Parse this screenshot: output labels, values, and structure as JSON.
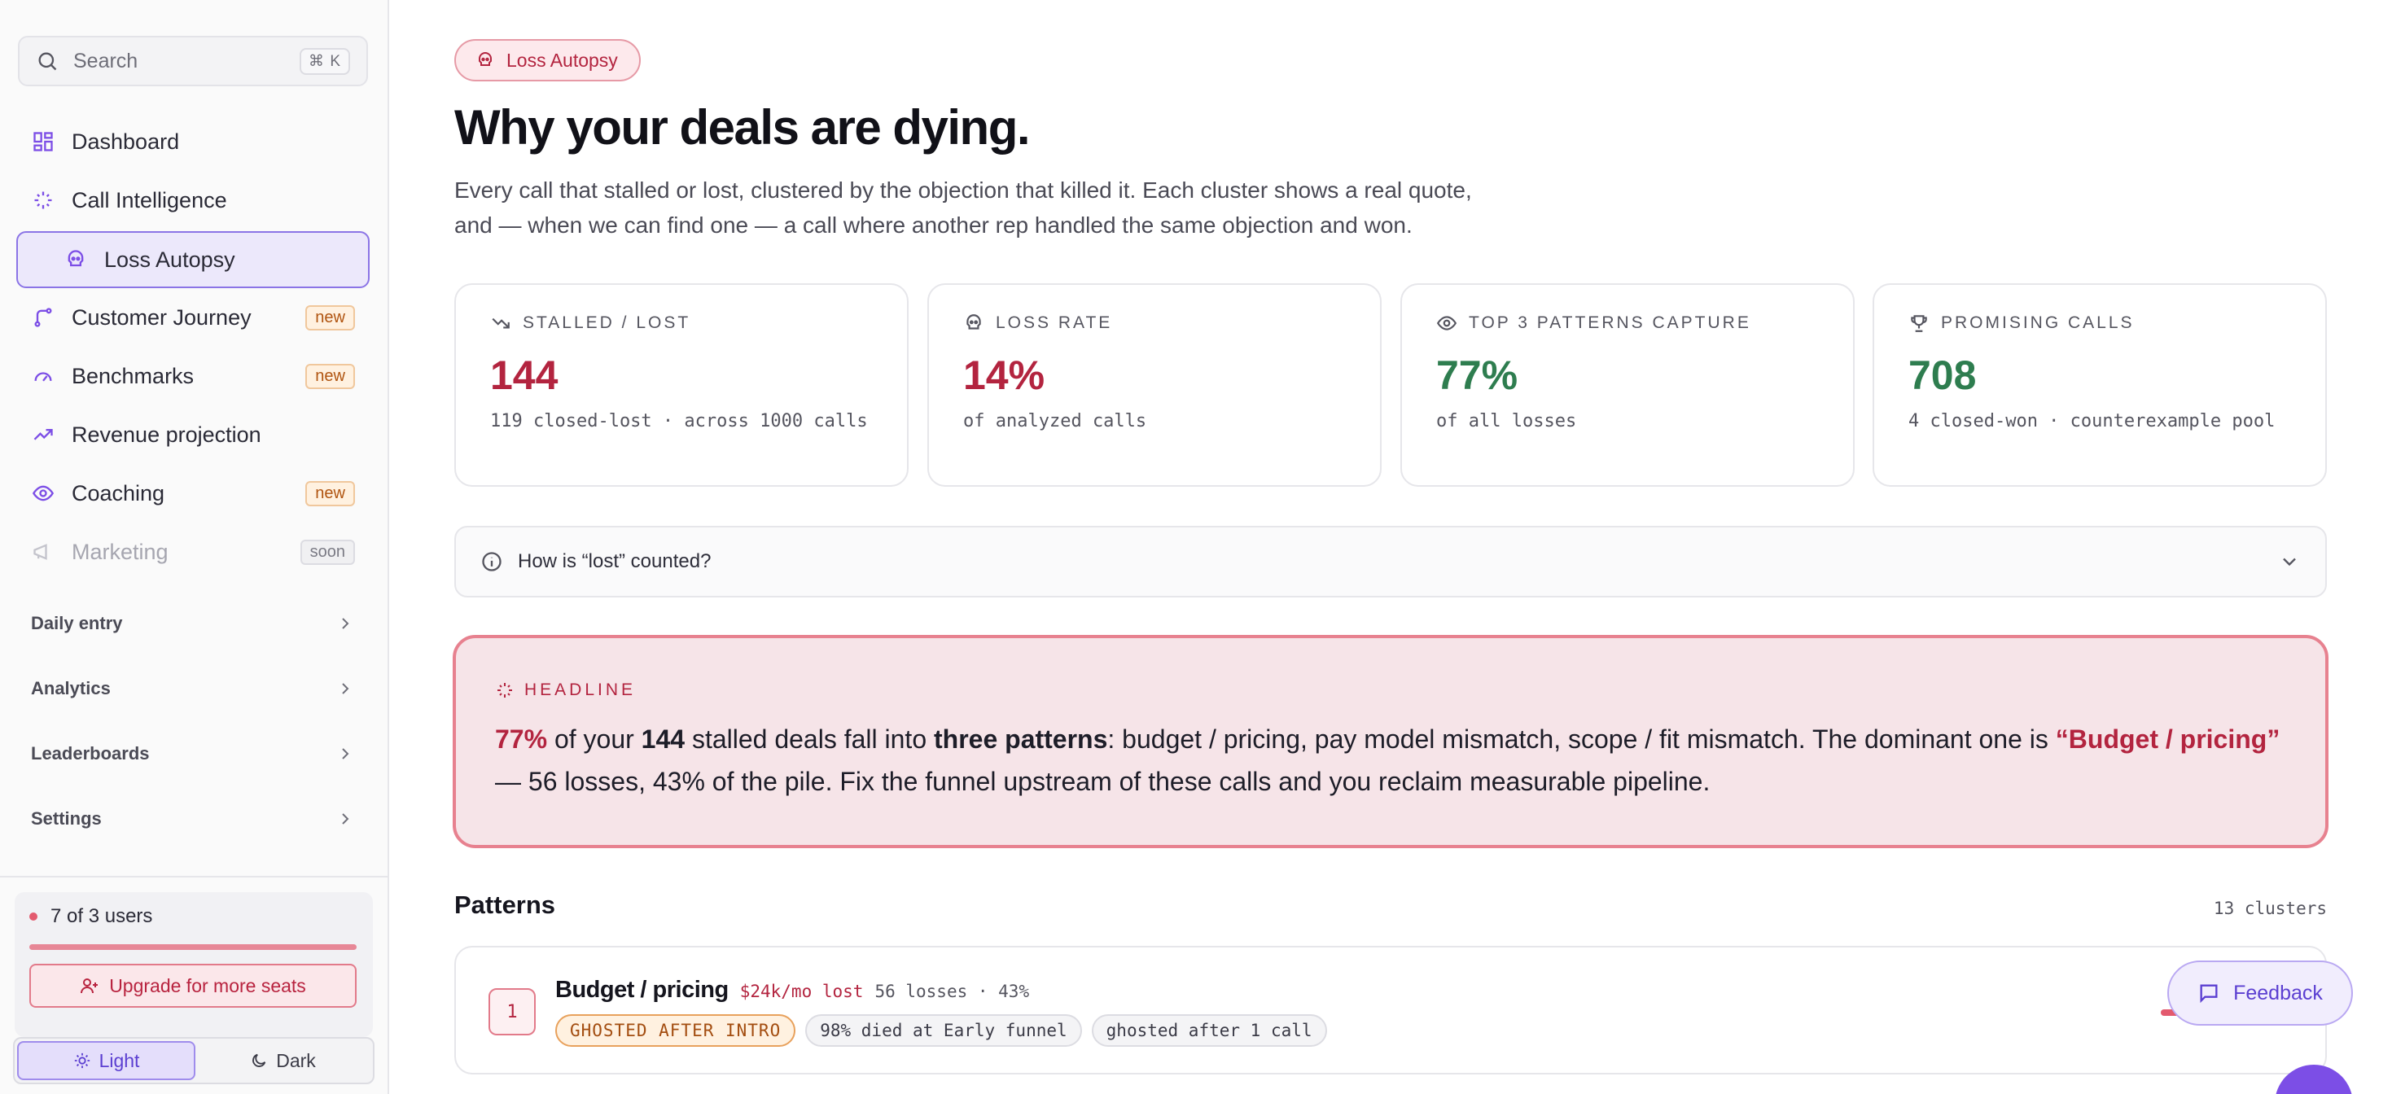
{
  "sidebar": {
    "search": {
      "placeholder": "Search",
      "shortcut": "⌘ K"
    },
    "nav": [
      {
        "label": "Dashboard",
        "icon": "grid-icon"
      },
      {
        "label": "Call Intelligence",
        "icon": "sparkle-icon"
      },
      {
        "label": "Loss Autopsy",
        "icon": "skull-icon",
        "active": true
      },
      {
        "label": "Customer Journey",
        "icon": "route-icon",
        "badge": "new"
      },
      {
        "label": "Benchmarks",
        "icon": "gauge-icon",
        "badge": "new"
      },
      {
        "label": "Revenue projection",
        "icon": "trending-up-icon"
      },
      {
        "label": "Coaching",
        "icon": "eye-icon",
        "badge": "new"
      },
      {
        "label": "Marketing",
        "icon": "megaphone-icon",
        "badge": "soon",
        "disabled": true
      }
    ],
    "sections": [
      "Daily entry",
      "Analytics",
      "Leaderboards",
      "Settings"
    ],
    "users": {
      "text": "7 of 3 users",
      "upgrade_label": "Upgrade for more seats"
    },
    "theme": {
      "light": "Light",
      "dark": "Dark"
    }
  },
  "main": {
    "pill": "Loss Autopsy",
    "title": "Why your deals are dying.",
    "subtitle_1": "Every call that stalled or lost, clustered by the objection that killed it. Each cluster shows a real quote,",
    "subtitle_2": "and — when we can find one — a call where another rep handled the same objection and won.",
    "stats": [
      {
        "label": "Stalled / Lost",
        "value": "144",
        "sub": "119 closed-lost · across 1000 calls",
        "icon": "trending-down-icon",
        "tone": "red"
      },
      {
        "label": "Loss rate",
        "value": "14%",
        "sub": "of analyzed calls",
        "icon": "skull-icon",
        "tone": "red"
      },
      {
        "label": "Top 3 patterns capture",
        "value": "77%",
        "sub": "of all losses",
        "icon": "eye-icon",
        "tone": "green"
      },
      {
        "label": "Promising calls",
        "value": "708",
        "sub": "4 closed-won · counterexample pool",
        "icon": "trophy-icon",
        "tone": "green"
      }
    ],
    "faq": "How is “lost” counted?",
    "headline": {
      "kicker": "Headline",
      "pct": "77%",
      "t1": " of your ",
      "count": "144",
      "t2": " stalled deals fall into ",
      "patterns": "three patterns",
      "t3": ": budget / pricing, pay model mismatch, scope / fit mismatch. The dominant one is ",
      "dominant": "“Budget / pricing”",
      "t4": " — 56 losses, 43% of the pile. Fix the funnel upstream of these calls and you reclaim measurable pipeline."
    },
    "patterns": {
      "title": "Patterns",
      "count": "13 clusters",
      "items": [
        {
          "rank": "1",
          "name": "Budget / pricing",
          "lost": "$24k/mo lost",
          "summary": "56 losses · 43%",
          "share": 0.43,
          "tags": [
            "GHOSTED AFTER INTRO",
            "98% died at Early funnel",
            "ghosted after 1 call"
          ]
        }
      ]
    },
    "feedback": "Feedback"
  },
  "colors": {
    "accent": "#7c4ee6",
    "danger": "#b3243f",
    "success": "#2e7d4f",
    "warning": "#b05410"
  }
}
